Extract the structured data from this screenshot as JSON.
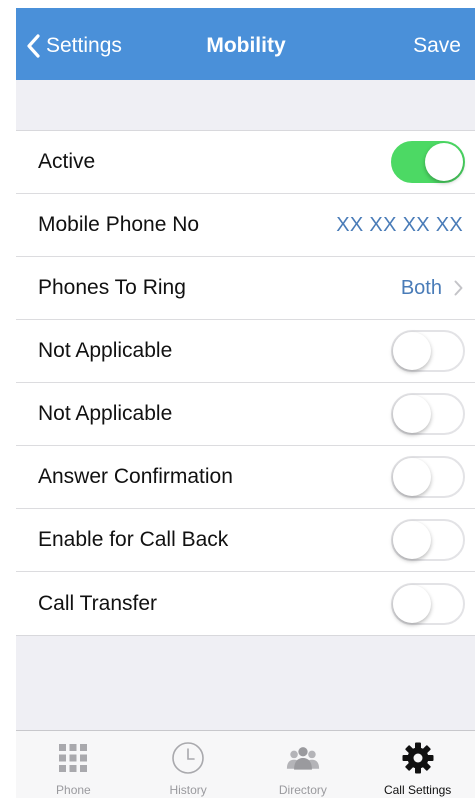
{
  "colors": {
    "nav_background": "#4a90d9",
    "toggle_on": "#4cd964",
    "value_text": "#4a7cb8",
    "group_background": "#efeff4"
  },
  "navbar": {
    "back_icon": "chevron-left-icon",
    "back_label": "Settings",
    "title": "Mobility",
    "save_label": "Save"
  },
  "rows": {
    "active": {
      "label": "Active",
      "toggle_on": true
    },
    "mobile_phone": {
      "label": "Mobile Phone No",
      "value": "XX XX XX XX"
    },
    "phones_to_ring": {
      "label": "Phones To Ring",
      "value": "Both",
      "icon": "chevron-right-icon"
    },
    "not_applicable_1": {
      "label": "Not Applicable",
      "toggle_on": false
    },
    "not_applicable_2": {
      "label": "Not Applicable",
      "toggle_on": false
    },
    "answer_confirmation": {
      "label": "Answer Confirmation",
      "toggle_on": false
    },
    "enable_call_back": {
      "label": "Enable for Call Back",
      "toggle_on": false
    },
    "call_transfer": {
      "label": "Call Transfer",
      "toggle_on": false
    }
  },
  "tabbar": {
    "phone": {
      "label": "Phone",
      "icon": "keypad-icon"
    },
    "history": {
      "label": "History",
      "icon": "clock-icon"
    },
    "directory": {
      "label": "Directory",
      "icon": "people-icon"
    },
    "call_settings": {
      "label": "Call Settings",
      "icon": "gear-icon",
      "active": true
    }
  }
}
